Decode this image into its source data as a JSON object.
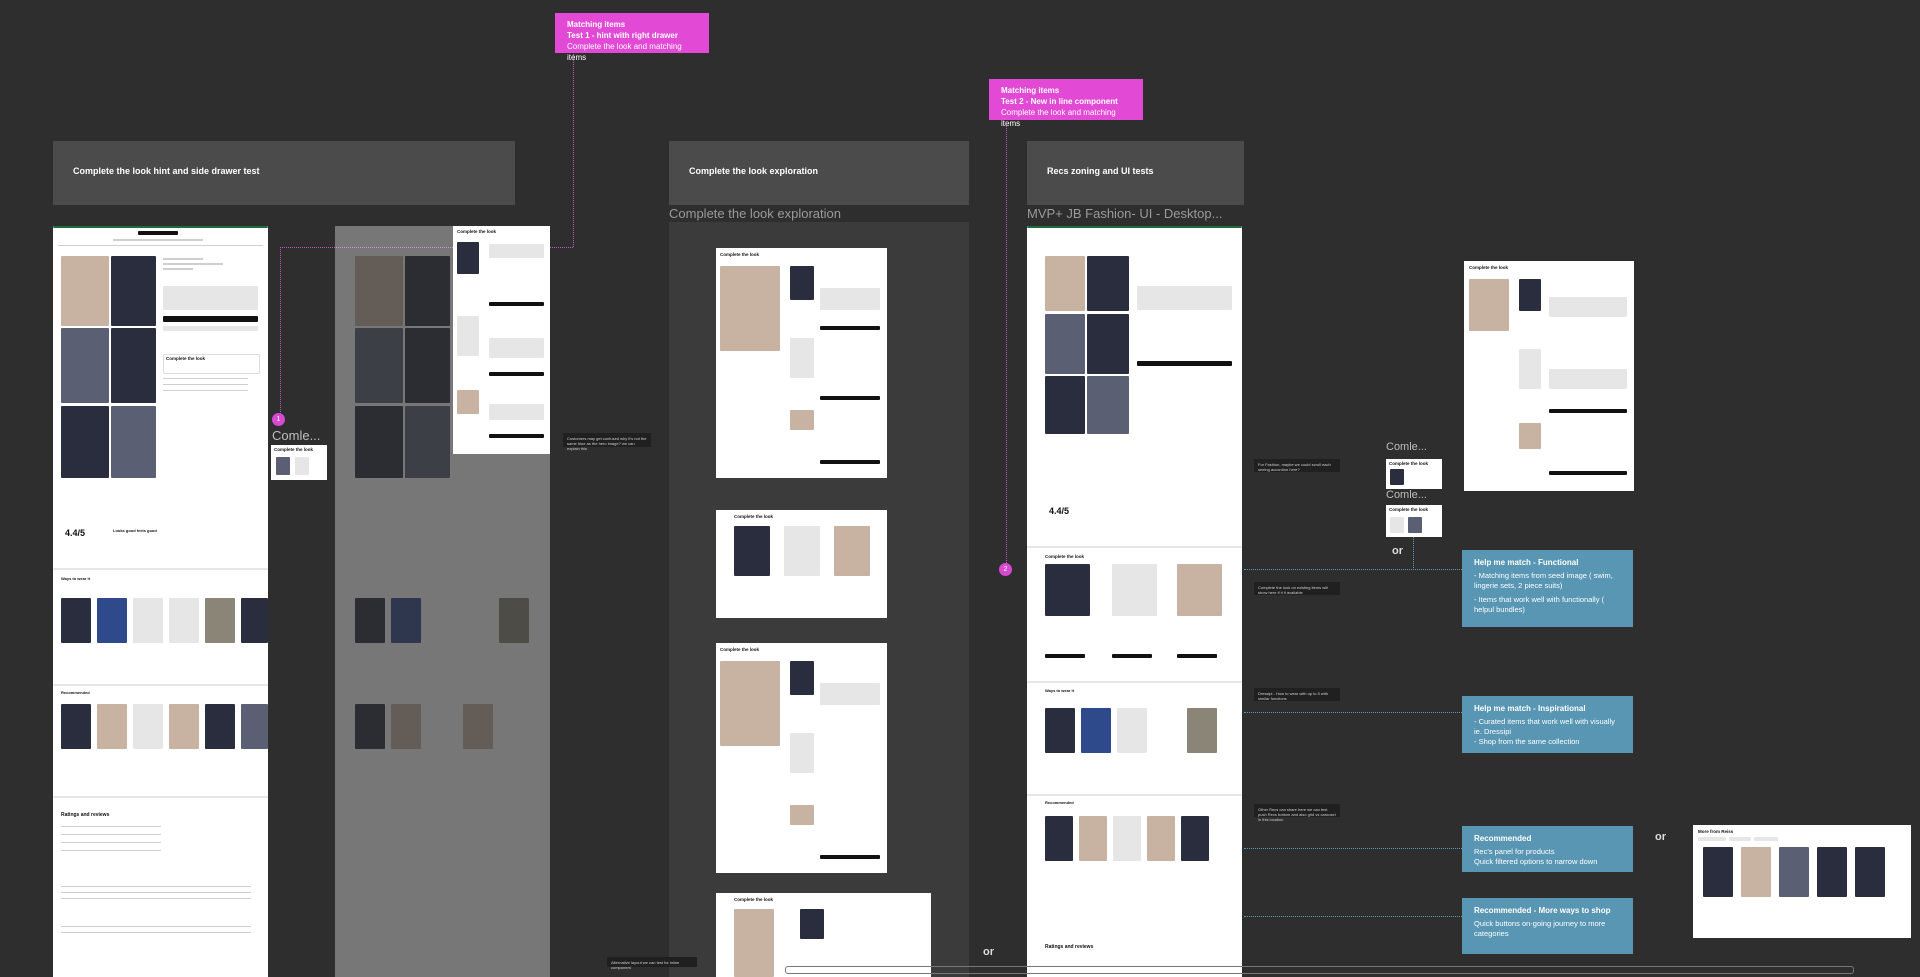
{
  "stickies": {
    "test1": {
      "title": "Matching items",
      "subtitle": "Test 1 - hint with right drawer",
      "body": "Complete the look and matching items"
    },
    "test2": {
      "title": "Matching items",
      "subtitle": "Test 2 - New in line component",
      "body": "Complete the look and matching items"
    }
  },
  "sections": {
    "hint_drawer": "Complete the look hint and side drawer test",
    "exploration": "Complete the look exploration",
    "recs_zoning": "Recs zoning and UI tests"
  },
  "frames": {
    "exploration_label": "Complete the look exploration",
    "mvp_label": "MVP+ JB Fashion- UI - Desktop..."
  },
  "mockup_text": {
    "complete_the_look": "Complete the look",
    "comple_truncated": "Comle...",
    "comple_truncated_left": "Comle...",
    "rating": "4.4/5",
    "looks_good": "Looks good feels good",
    "ways_to_wear": "Ways to wear it",
    "recommended": "Recommended",
    "ratings_reviews": "Ratings and reviews",
    "more_from": "More from Reiss"
  },
  "pins": {
    "one": "1",
    "two": "2"
  },
  "blue_cards": [
    {
      "title": "Help me match - Functional",
      "lines": [
        "- Matching items from seed image ( swim, lingerie sets, 2 piece suits)",
        "- Items that work well with functionally ( helpul bundles)"
      ]
    },
    {
      "title": "Help me match - Inspirational",
      "lines": [
        "- Curated items that work well with visually ie. Dressipi",
        "- Shop from the same collection"
      ]
    },
    {
      "title": "Recommended",
      "lines": [
        "Rec's panel for products",
        "Quick filtered options to narrow down"
      ]
    },
    {
      "title": "Recommended - More ways to shop",
      "lines": [
        "Quick buttons on-going journey to more categories"
      ]
    }
  ],
  "notes": {
    "drawer_note": "Customers may get confused why it's not the same blue as the hero image? we can explain this",
    "fashion_note": "For Fashion, maybe we could scroll each seeing accordion here?",
    "complete_note": "Complete the look on existing items will show here if it if available",
    "dressipi_note": "Dressipi - How to wear with up to 5 with similar functions",
    "other_note": "Other Recs can share here we can test push Recs bottom and also grid vs carousel in this location",
    "alt_layout": "Alternative layout we can test for inline component"
  },
  "or_labels": {
    "a": "or",
    "b": "or",
    "c": "or"
  },
  "colors": {
    "sticky": "#e24ad6",
    "blue_card": "#5896b3",
    "canvas": "#2e2e2e",
    "section": "#4b4b4b"
  }
}
